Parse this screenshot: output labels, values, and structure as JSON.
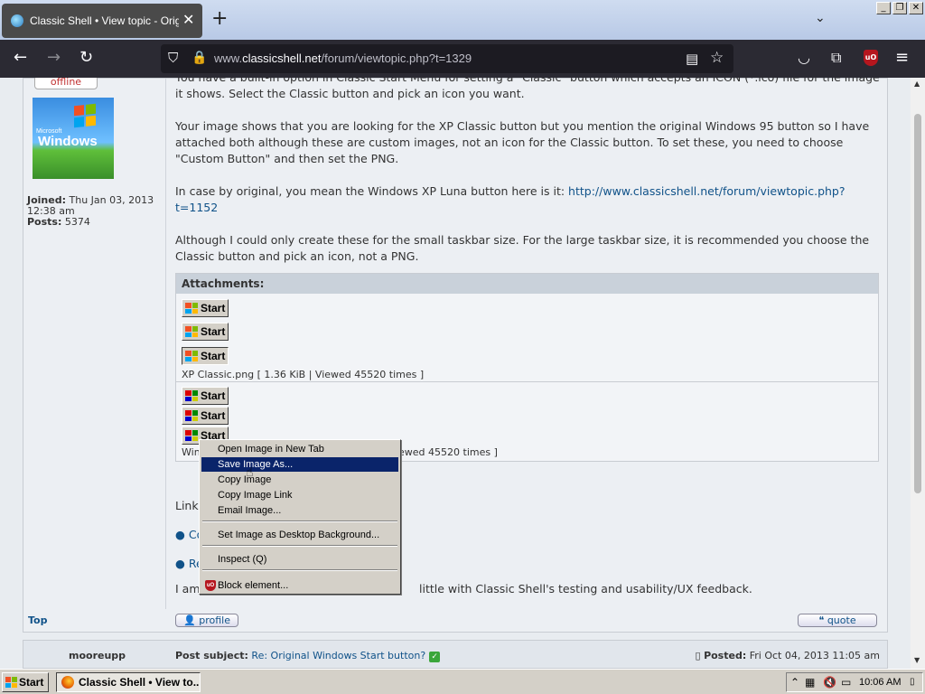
{
  "browser": {
    "tab_title": "Classic Shell • View topic - Original Windows Start button?",
    "tab_close": "✕",
    "new_tab": "+",
    "tab_list": "⌄",
    "url_prefix": "www.",
    "url_domain": "classicshell.net",
    "url_path": "/forum/viewtopic.php?t=1329",
    "window_buttons": [
      "_",
      "❐",
      "✕"
    ]
  },
  "author": {
    "status": "offline",
    "avatar_text": "Windows",
    "avatar_small": "Microsoft",
    "joined_label": "Joined:",
    "joined_value": "Thu Jan 03, 2013 12:38 am",
    "posts_label": "Posts:",
    "posts_value": "5374"
  },
  "post": {
    "p1": "You have a built-in option in Classic Start Menu for setting a \"Classic\" button which accepts an ICON (*.ico) file for the image it shows. Select the Classic button and pick an icon you want.",
    "p2": "Your image shows that you are looking for the XP Classic button but you mention the original Windows 95 button so I have attached both although these are custom images, not an icon for the Classic button. To set these, you need to choose \"Custom Button\" and then set the PNG.",
    "p3_text": "In case by original, you mean the Windows XP Luna button here is it: ",
    "p3_link": "http://www.classicshell.net/forum/viewtopic.php?t=1152",
    "p4": "Although I could only create these for the small taskbar size. For the large taskbar size, it is recommended you choose the Classic button and pick an icon, not a PNG.",
    "attachments_label": "Attachments:",
    "start_label": "Start",
    "att1_caption": "XP Classic.png [ 1.36 KiB | Viewed 45520 times ]",
    "att2_caption_start": "Win",
    "att2_caption_end": "ewed 45520 times ]",
    "links_label": "Links",
    "link1": "Co",
    "link2": "Re",
    "last_start": "I am",
    "last_end": "little with Classic Shell's testing and usability/UX feedback.",
    "top_label": "Top",
    "profile_label": "profile",
    "quote_label": "quote"
  },
  "next_post": {
    "author": "mooreupp",
    "subject_label": "Post subject:",
    "subject": "Re: Original Windows Start button?",
    "posted_label": "Posted:",
    "posted_value": "Fri Oct 04, 2013 11:05 am"
  },
  "context_menu": {
    "items": [
      "Open Image in New Tab",
      "Save Image As...",
      "Copy Image",
      "Copy Image Link",
      "Email Image...",
      "Set Image as Desktop Background...",
      "Inspect (Q)",
      "Block element..."
    ],
    "selected_index": 1
  },
  "taskbar": {
    "start": "Start",
    "item": "Classic Shell • View to...",
    "time": "10:06 AM"
  },
  "colors": {
    "link": "#105289",
    "menu_highlight": "#0a246a",
    "browser_dark": "#2b2a33"
  }
}
